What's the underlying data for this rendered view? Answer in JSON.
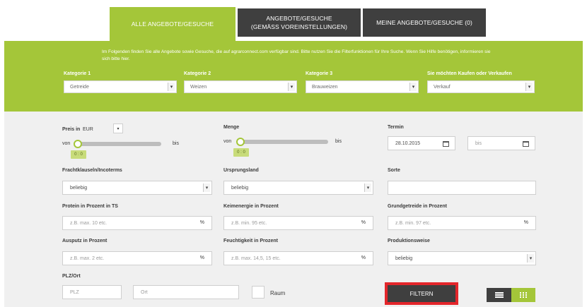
{
  "tabs": {
    "all": "ALLE ANGEBOTE/GESUCHE",
    "settings_line1": "ANGEBOTE/GESUCHE",
    "settings_line2": "(GEMÄSS VOREINSTELLUNGEN)",
    "mine": "MEINE ANGEBOTE/GESUCHE (0)"
  },
  "intro": "Im Folgenden finden Sie alle Angebote sowie Gesuche, die auf agrarconnect.com verfügbar sind. Bitte nutzen Sie die Filterfunktionen für Ihre Suche. Wenn Sie Hilfe benötigen, informieren sie sich bitte hier.",
  "categories": {
    "k1_label": "Kategorie 1",
    "k1_value": "Getreide",
    "k2_label": "Kategorie 2",
    "k2_value": "Weizen",
    "k3_label": "Kategorie 3",
    "k3_value": "Brauweizen",
    "k4_label": "Sie möchten Kaufen oder Verkaufen",
    "k4_value": "Verkauf"
  },
  "price": {
    "label": "Preis in",
    "currency": "EUR",
    "from": "von",
    "to": "bis",
    "range": "0 : 0"
  },
  "amount": {
    "label": "Menge",
    "from": "von",
    "to": "bis",
    "range": "0 : 0"
  },
  "date": {
    "label": "Termin",
    "from_value": "28.10.2015",
    "to_placeholder": "bis"
  },
  "fields": {
    "fracht_label": "Frachtklauseln/Incoterms",
    "fracht_value": "beliebig",
    "ursprung_label": "Ursprungsland",
    "ursprung_value": "beliebig",
    "sorte_label": "Sorte",
    "protein_label": "Protein in Prozent in TS",
    "protein_ph": "z.B. max. 10 etc.",
    "keim_label": "Keimenergie in Prozent",
    "keim_ph": "z.B. min. 95 etc.",
    "grund_label": "Grundgetreide in Prozent",
    "grund_ph": "z.B. min. 97 etc.",
    "auspu_label": "Ausputz in Prozent",
    "auspu_ph": "z.B. max. 2 etc.",
    "feucht_label": "Feuchtigkeit in Prozent",
    "feucht_ph": "z.B. max. 14,5, 15 etc.",
    "prod_label": "Produktionsweise",
    "prod_value": "beliebig",
    "pct": "%",
    "plz_label": "PLZ/Ort",
    "plz_ph": "PLZ",
    "ort_ph": "Ort",
    "raum_label": "Raum"
  },
  "actions": {
    "filter": "FILTERN",
    "list_view_icon": "list-icon",
    "grid_view_icon": "grid-icon"
  },
  "colors": {
    "accent_green": "#a4c639",
    "dark_tab": "#3f3f3f",
    "highlight_red": "#e3262b"
  }
}
